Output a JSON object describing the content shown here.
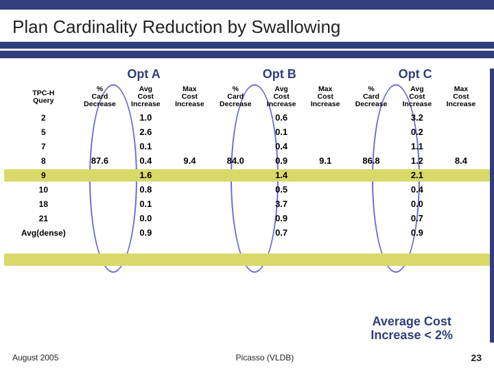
{
  "title": "Plan Cardinality Reduction by Swallowing",
  "opts": {
    "a": "Opt A",
    "b": "Opt B",
    "c": "Opt C"
  },
  "headers": {
    "query": "TPC-H\nQuery",
    "card": "%\nCard\nDecrease",
    "avg": "Avg\nCost\nIncrease",
    "max": "Max\nCost\nIncrease"
  },
  "query_ids": [
    "2",
    "5",
    "7",
    "8",
    "9",
    "10",
    "18",
    "21",
    "Avg(dense)"
  ],
  "optA": {
    "card": "87.6",
    "avg": [
      "1.0",
      "2.6",
      "0.1",
      "0.4",
      "1.6",
      "0.8",
      "0.1",
      "0.0",
      "0.9"
    ],
    "max": "9.4"
  },
  "optB": {
    "card": "84.0",
    "avg": [
      "0.6",
      "0.1",
      "0.4",
      "0.9",
      "1.4",
      "0.5",
      "3.7",
      "0.9",
      "0.7"
    ],
    "max": "9.1"
  },
  "optC": {
    "card": "86.8",
    "avg": [
      "3.2",
      "0.2",
      "1.1",
      "1.2",
      "2.1",
      "0.4",
      "0.0",
      "0.7",
      "0.9"
    ],
    "max": "8.4"
  },
  "callout": "Average Cost\nIncrease < 2%",
  "footer": {
    "date": "August 2005",
    "center": "Picasso (VLDB)",
    "page": "23"
  }
}
